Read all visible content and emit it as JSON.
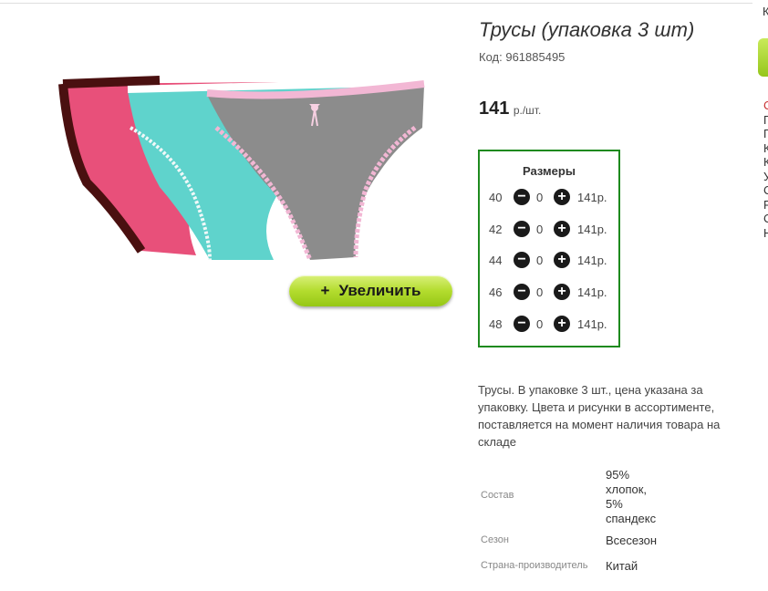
{
  "product": {
    "title": "Трусы (упаковка 3 шт)",
    "code_label": "Код:",
    "code_value": "961885495",
    "price_value": "141",
    "price_unit": "р./шт.",
    "zoom_button_label": "Увеличить",
    "zoom_button_icon": "plus-icon"
  },
  "sizes": {
    "title": "Размеры",
    "rows": [
      {
        "size": "40",
        "qty": "0",
        "price": "141р."
      },
      {
        "size": "42",
        "qty": "0",
        "price": "141р."
      },
      {
        "size": "44",
        "qty": "0",
        "price": "141р."
      },
      {
        "size": "46",
        "qty": "0",
        "price": "141р."
      },
      {
        "size": "48",
        "qty": "0",
        "price": "141р."
      }
    ],
    "minus_symbol": "−",
    "plus_symbol": "+"
  },
  "description": "Трусы. В упаковке 3 шт., цена указана за упаковку. Цвета и рисунки в ассортименте, поставляется на момент наличия товара на складе",
  "attributes": [
    {
      "label": "Состав",
      "value_lines": [
        "95%",
        "хлопок,",
        "5%",
        "спандекс"
      ]
    },
    {
      "label": "Сезон",
      "value_lines": [
        "Всесезон"
      ]
    },
    {
      "label": "Страна-производитель",
      "value_lines": [
        "Китай"
      ]
    }
  ],
  "edge_column": {
    "top_letter": "К",
    "letters": [
      "С",
      "П",
      "П",
      "К",
      "К",
      "У",
      "С",
      "Р",
      "С",
      "Н"
    ]
  },
  "colors": {
    "accent_green_border": "#1e8a1e",
    "button_green": "#b3dc2e",
    "edge_red": "#c83232"
  }
}
